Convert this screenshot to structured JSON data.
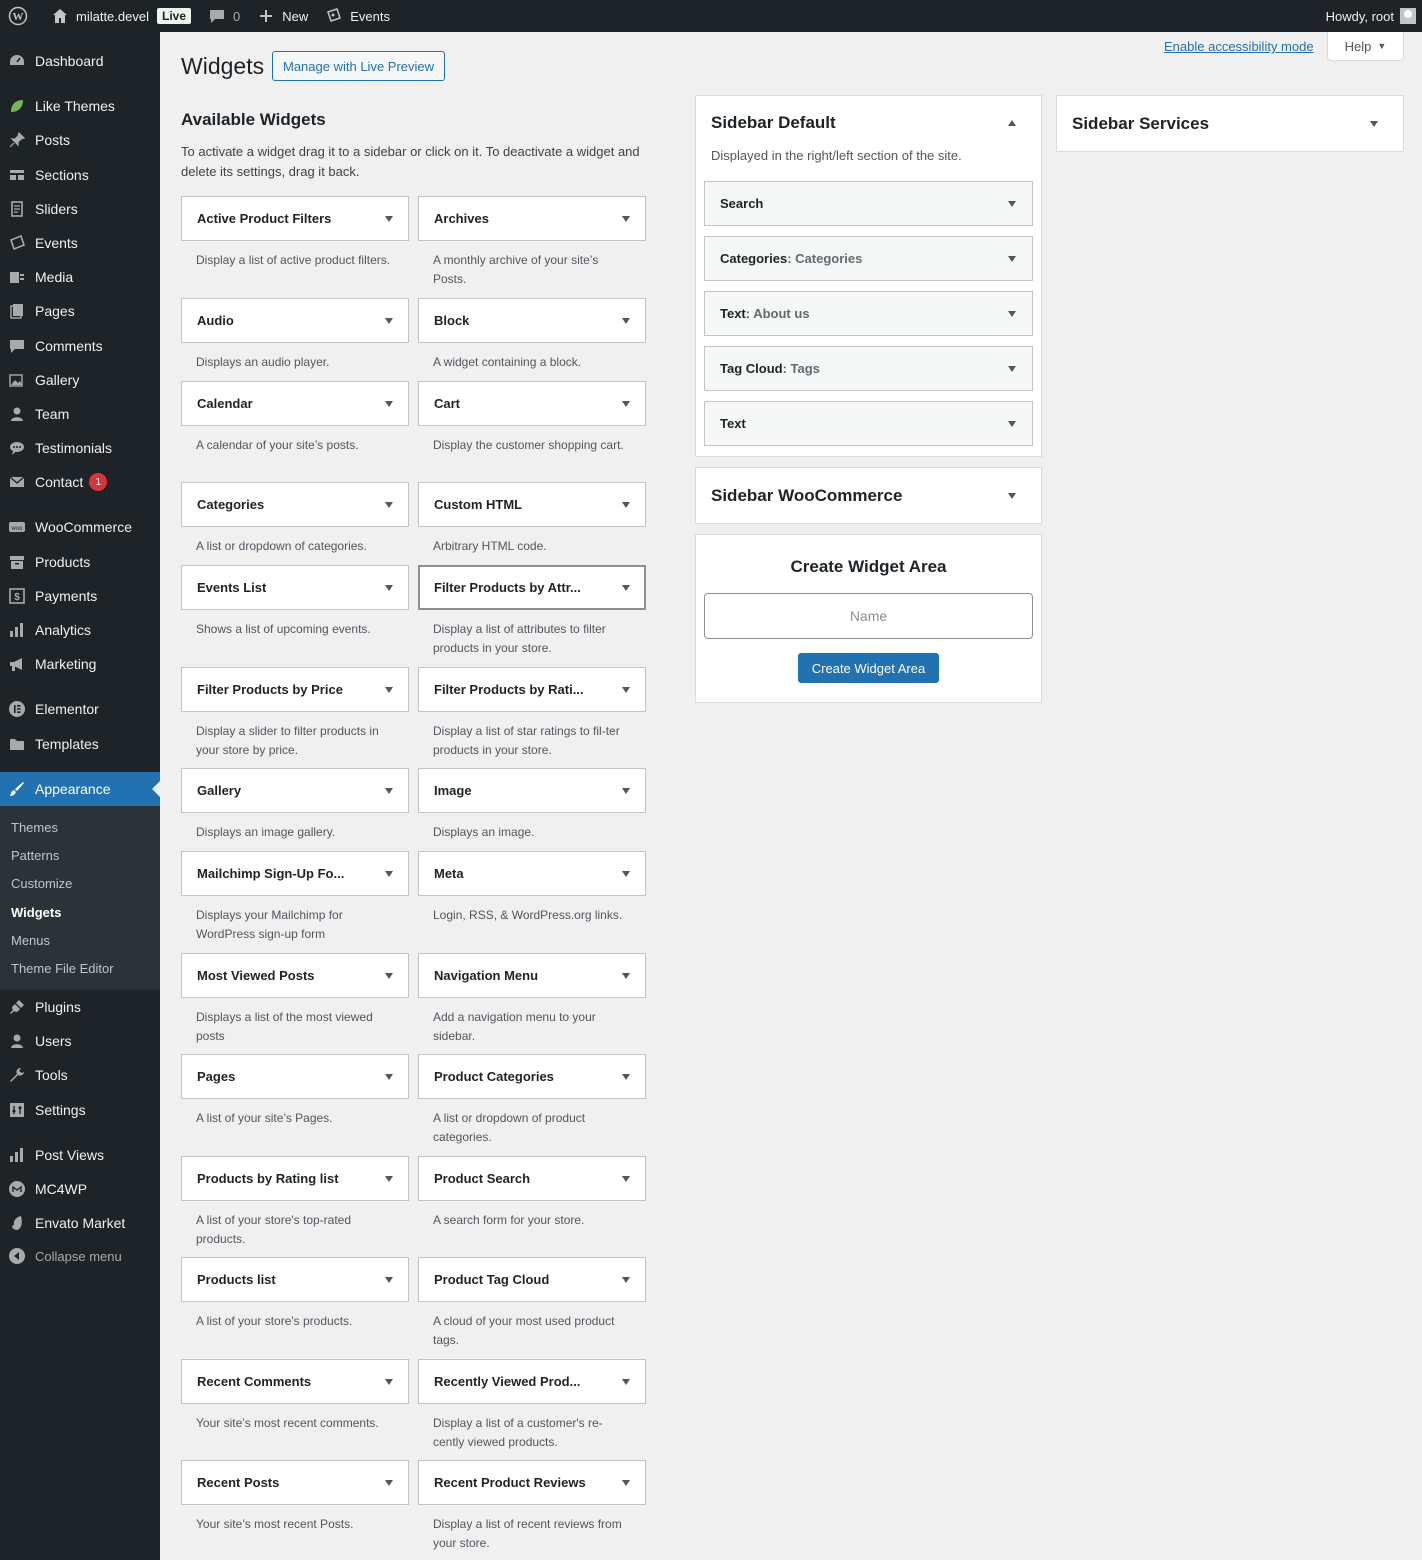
{
  "adminbar": {
    "site_name": "milatte.devel",
    "live_badge": "Live",
    "comments_count": "0",
    "new_label": "New",
    "events_label": "Events",
    "howdy": "Howdy, root"
  },
  "menu": {
    "items": [
      {
        "label": "Dashboard",
        "icon": "dashboard-icon"
      },
      {
        "label": "Like Themes",
        "icon": "leaf-icon"
      },
      {
        "label": "Posts",
        "icon": "pin-icon"
      },
      {
        "label": "Sections",
        "icon": "sections-icon"
      },
      {
        "label": "Sliders",
        "icon": "sliders-icon"
      },
      {
        "label": "Events",
        "icon": "tickets-icon"
      },
      {
        "label": "Media",
        "icon": "media-icon"
      },
      {
        "label": "Pages",
        "icon": "pages-icon"
      },
      {
        "label": "Comments",
        "icon": "comments-icon"
      },
      {
        "label": "Gallery",
        "icon": "gallery-icon"
      },
      {
        "label": "Team",
        "icon": "user-icon"
      },
      {
        "label": "Testimonials",
        "icon": "testimonials-icon"
      },
      {
        "label": "Contact",
        "icon": "mail-icon",
        "badge": "1"
      },
      {
        "label": "WooCommerce",
        "icon": "woo-icon"
      },
      {
        "label": "Products",
        "icon": "archive-icon"
      },
      {
        "label": "Payments",
        "icon": "payments-icon"
      },
      {
        "label": "Analytics",
        "icon": "bar-chart-icon"
      },
      {
        "label": "Marketing",
        "icon": "megaphone-icon"
      },
      {
        "label": "Elementor",
        "icon": "elementor-icon"
      },
      {
        "label": "Templates",
        "icon": "folder-icon"
      },
      {
        "label": "Appearance",
        "icon": "brush-icon"
      },
      {
        "label": "Plugins",
        "icon": "plugin-icon"
      },
      {
        "label": "Users",
        "icon": "users-icon"
      },
      {
        "label": "Tools",
        "icon": "wrench-icon"
      },
      {
        "label": "Settings",
        "icon": "settings-icon"
      },
      {
        "label": "Post Views",
        "icon": "bar-chart-icon"
      },
      {
        "label": "MC4WP",
        "icon": "mc4wp-icon"
      },
      {
        "label": "Envato Market",
        "icon": "envato-icon"
      },
      {
        "label": "Collapse menu",
        "icon": "collapse-icon"
      }
    ],
    "submenu": [
      "Themes",
      "Patterns",
      "Customize",
      "Widgets",
      "Menus",
      "Theme File Editor"
    ]
  },
  "header": {
    "title": "Widgets",
    "live_preview_button": "Manage with Live Preview",
    "accessibility_link": "Enable accessibility mode",
    "help_tab": "Help"
  },
  "available": {
    "title": "Available Widgets",
    "description": "To activate a widget drag it to a sidebar or click on it. To deactivate a widget and delete its settings, drag it back.",
    "widgets": [
      {
        "name": "Active Product Filters",
        "desc": "Display a list of active product filters."
      },
      {
        "name": "Archives",
        "desc": "A monthly archive of your site’s Posts."
      },
      {
        "name": "Audio",
        "desc": "Displays an audio player."
      },
      {
        "name": "Block",
        "desc": "A widget containing a block."
      },
      {
        "name": "Calendar",
        "desc": "A calendar of your site’s posts."
      },
      {
        "name": "Cart",
        "desc": "Display the customer shopping cart."
      },
      {
        "name": "Categories",
        "desc": "A list or dropdown of categories."
      },
      {
        "name": "Custom HTML",
        "desc": "Arbitrary HTML code."
      },
      {
        "name": "Events List",
        "desc": "Shows a list of upcoming events."
      },
      {
        "name": "Filter Products by Attr...",
        "desc": "Display a list of attributes to filter products in your store."
      },
      {
        "name": "Filter Products by Price",
        "desc": "Display a slider to filter products in your store by price."
      },
      {
        "name": "Filter Products by Rati...",
        "desc": "Display a list of star ratings to fil-ter products in your store."
      },
      {
        "name": "Gallery",
        "desc": "Displays an image gallery."
      },
      {
        "name": "Image",
        "desc": "Displays an image."
      },
      {
        "name": "Mailchimp Sign-Up Fo...",
        "desc": "Displays your Mailchimp for WordPress sign-up form"
      },
      {
        "name": "Meta",
        "desc": "Login, RSS, & WordPress.org links."
      },
      {
        "name": "Most Viewed Posts",
        "desc": "Displays a list of the most viewed posts"
      },
      {
        "name": "Navigation Menu",
        "desc": "Add a navigation menu to your sidebar."
      },
      {
        "name": "Pages",
        "desc": "A list of your site’s Pages."
      },
      {
        "name": "Product Categories",
        "desc": "A list or dropdown of product categories."
      },
      {
        "name": "Products by Rating list",
        "desc": "A list of your store's top-rated products."
      },
      {
        "name": "Product Search",
        "desc": "A search form for your store."
      },
      {
        "name": "Products list",
        "desc": "A list of your store's products."
      },
      {
        "name": "Product Tag Cloud",
        "desc": "A cloud of your most used product tags."
      },
      {
        "name": "Recent Comments",
        "desc": "Your site’s most recent comments."
      },
      {
        "name": "Recently Viewed Prod...",
        "desc": "Display a list of a customer's re-cently viewed products."
      },
      {
        "name": "Recent Posts",
        "desc": "Your site’s most recent Posts."
      },
      {
        "name": "Recent Product Reviews",
        "desc": "Display a list of recent reviews from your store."
      }
    ]
  },
  "sidebar_default": {
    "title": "Sidebar Default",
    "description": "Displayed in the right/left section of the site.",
    "widgets": [
      {
        "name": "Search",
        "title": ""
      },
      {
        "name": "Categories",
        "title": ": Categories"
      },
      {
        "name": "Text",
        "title": ": About us"
      },
      {
        "name": "Tag Cloud",
        "title": ": Tags"
      },
      {
        "name": "Text",
        "title": ""
      }
    ]
  },
  "sidebar_woocommerce": {
    "title": "Sidebar WooCommerce"
  },
  "sidebar_services": {
    "title": "Sidebar Services"
  },
  "create_area": {
    "title": "Create Widget Area",
    "placeholder": "Name",
    "button": "Create Widget Area"
  },
  "colors": {
    "admin_dark": "#1d2327",
    "accent": "#2271b1",
    "badge": "#d63638"
  }
}
